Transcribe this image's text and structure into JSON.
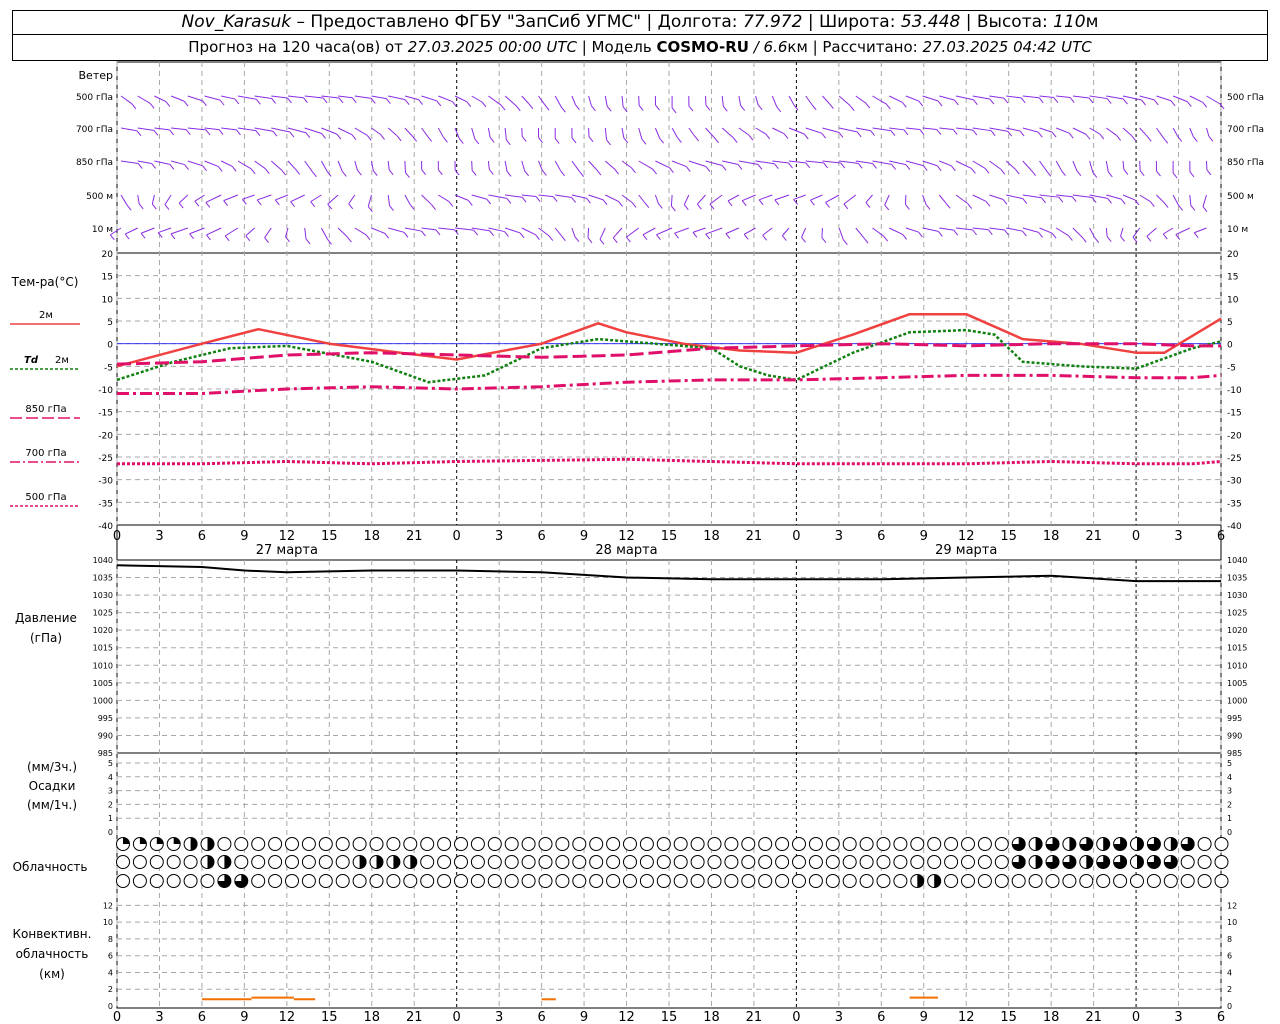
{
  "header": {
    "station": "Nov_Karasuk",
    "provider": " – Предоставлено ФГБУ \"ЗапСиб УГМС\" | ",
    "lon_label": "Долгота: ",
    "lon": "77.972",
    "lat_label": " | Широта: ",
    "lat": "53.448",
    "alt_label": " | Высота: ",
    "alt": "110",
    "alt_unit": "м",
    "fc_label": "Прогноз на 120 часа(ов) от ",
    "fc_time": "27.03.2025 00:00 UTC",
    "model_label": "  | Модель ",
    "model": "COSMO-RU",
    "res": " / 6.6",
    "res_unit": "км",
    "calc_label": " | Рассчитано: ",
    "calc_time": "27.03.2025 04:42 UTC"
  },
  "colors": {
    "wind": "#8a2be2",
    "t2m": "#f04040",
    "td2m": "#108010",
    "t850": "#e0106a",
    "t700": "#e0106a",
    "t500": "#e0106a",
    "pressure": "#000000",
    "convective": "#f07000",
    "zero_line": "#2020ff",
    "grid": "#a8a8a8"
  },
  "labels": {
    "wind_title": "Ветер",
    "wind_levels": [
      "500 гПа",
      "700 гПа",
      "850 гПа",
      "500 м",
      "10 м"
    ],
    "temp_title": "Тем-ра(°C)",
    "legend_t2m": "2м",
    "legend_td_a": "Td",
    "legend_td_b": "2м",
    "legend_850": "850 гПа",
    "legend_700": "700 гПа",
    "legend_500": "500 гПа",
    "pressure_title_1": "Давление",
    "pressure_title_2": "(гПа)",
    "precip_title_1": "(мм/3ч.)",
    "precip_title_2": "Осадки",
    "precip_title_3": "(мм/1ч.)",
    "cloud_title": "Облачность",
    "conv_title_1": "Конвективн.",
    "conv_title_2": "облачность",
    "conv_title_3": "(км)",
    "days": [
      "27 марта",
      "28 марта",
      "29 марта"
    ]
  },
  "chart_data": {
    "type": "line",
    "x_ticks": [
      "0",
      "3",
      "6",
      "9",
      "12",
      "15",
      "18",
      "21",
      "0",
      "3",
      "6",
      "9",
      "12",
      "15",
      "18",
      "21",
      "0",
      "3",
      "6",
      "9",
      "12",
      "15",
      "18",
      "21",
      "0",
      "3",
      "6"
    ],
    "x_hours": [
      0,
      6,
      12,
      18,
      24,
      30,
      36,
      42,
      48,
      54,
      60,
      66,
      72,
      78
    ],
    "temperature": {
      "ylim": [
        -40,
        20
      ],
      "yticks": [
        20,
        15,
        10,
        5,
        0,
        -5,
        -10,
        -15,
        -20,
        -25,
        -30,
        -35,
        -40
      ],
      "series": [
        {
          "key": "t2m",
          "values": [
            -5,
            0,
            3.2,
            0,
            -2,
            -3.5,
            0,
            4.5,
            2.5,
            0,
            -1.5,
            -2,
            2,
            6.5,
            6.5,
            1,
            0,
            -2,
            -2,
            5.5
          ],
          "hours": [
            0,
            6,
            10,
            15,
            20,
            24,
            30,
            34,
            36,
            40,
            44,
            48,
            52,
            56,
            60,
            64,
            68,
            72,
            74,
            78
          ]
        },
        {
          "key": "td2m",
          "values": [
            -8,
            -4,
            -1,
            -0.5,
            -4,
            -8.5,
            -7,
            -1,
            1,
            0,
            -1,
            -5,
            -7,
            -8,
            -2,
            2.5,
            3,
            2,
            -4,
            -5,
            -5.5,
            -1,
            0.5
          ],
          "hours": [
            0,
            4,
            8,
            12,
            18,
            22,
            26,
            30,
            34,
            38,
            42,
            44,
            46,
            48,
            52,
            56,
            60,
            62,
            64,
            68,
            72,
            76,
            78
          ]
        },
        {
          "key": "t850",
          "values": [
            -4.5,
            -4,
            -2.5,
            -2,
            -2.5,
            -3,
            -2.5,
            -1,
            -0.5,
            0,
            -0.5,
            0,
            0,
            -0.5,
            -0.5
          ],
          "hours": [
            0,
            6,
            12,
            18,
            24,
            30,
            36,
            42,
            48,
            54,
            60,
            66,
            72,
            76,
            78
          ]
        },
        {
          "key": "t700",
          "values": [
            -11,
            -11,
            -10,
            -9.5,
            -10,
            -9.5,
            -8.5,
            -8,
            -8,
            -7.5,
            -7,
            -7,
            -7.5,
            -7.5,
            -7
          ],
          "hours": [
            0,
            6,
            12,
            18,
            24,
            30,
            36,
            42,
            48,
            54,
            60,
            66,
            72,
            76,
            78
          ]
        },
        {
          "key": "t500",
          "values": [
            -26.5,
            -26.5,
            -26,
            -26.5,
            -26,
            -25.5,
            -26,
            -26.5,
            -26.5,
            -26.5,
            -26,
            -26.5,
            -26.5,
            -26
          ],
          "hours": [
            0,
            6,
            12,
            18,
            24,
            36,
            42,
            48,
            54,
            60,
            66,
            72,
            76,
            78
          ]
        }
      ]
    },
    "pressure": {
      "ylim": [
        985,
        1040
      ],
      "yticks": [
        1040,
        1035,
        1030,
        1025,
        1020,
        1015,
        1010,
        1005,
        1000,
        995,
        990,
        985
      ],
      "values": [
        1038.5,
        1038,
        1037,
        1036.5,
        1037,
        1037,
        1036.5,
        1035,
        1034.5,
        1034.5,
        1034.5,
        1035,
        1035.5,
        1034,
        1034,
        1034.5,
        1034.5,
        1034.5,
        1035.5,
        1035.5
      ],
      "hours": [
        0,
        6,
        9,
        12,
        18,
        24,
        30,
        36,
        42,
        48,
        54,
        60,
        66,
        72,
        78
      ]
    },
    "precipitation": {
      "ylim": [
        0,
        5
      ],
      "yticks": [
        5,
        4,
        3,
        2,
        1,
        0
      ],
      "values": []
    },
    "cloudiness": {
      "note": "okta-like fractions per hour, 3 layers",
      "upper": [
        1,
        1,
        1,
        1,
        1,
        1,
        2,
        2,
        1,
        1,
        1,
        1,
        1,
        1,
        1,
        1,
        1,
        1,
        1,
        1,
        1,
        1,
        1,
        1,
        1,
        1,
        1,
        1,
        1,
        1,
        1,
        1,
        1,
        1,
        1,
        1,
        1,
        1,
        1,
        1,
        1,
        1,
        1,
        1,
        1,
        1,
        1,
        1,
        1,
        1,
        1,
        1,
        1,
        1,
        1,
        1,
        1,
        1,
        1,
        1,
        1,
        1,
        1,
        1,
        1,
        1,
        1,
        1,
        1,
        1,
        1,
        1,
        1,
        1,
        1,
        1,
        1,
        1,
        1,
        1,
        1,
        1,
        1,
        1,
        1,
        1,
        1,
        1,
        1,
        1,
        1,
        1,
        1,
        1,
        1,
        1,
        1,
        1,
        1,
        1,
        1,
        1,
        1,
        1,
        1,
        1,
        1,
        1,
        1,
        1,
        1,
        1,
        1,
        1,
        1,
        1,
        1,
        1,
        1,
        1,
        1
      ],
      "cells_per_row": 66
    },
    "convective": {
      "ylim": [
        0,
        13
      ],
      "yticks": [
        12,
        10,
        8,
        6,
        4,
        2,
        0
      ],
      "segments": [
        [
          6,
          9.5,
          0.8
        ],
        [
          9.5,
          12.5,
          1
        ],
        [
          12.5,
          14,
          0.8
        ],
        [
          30,
          31,
          0.8
        ],
        [
          56,
          58,
          1
        ]
      ]
    }
  }
}
